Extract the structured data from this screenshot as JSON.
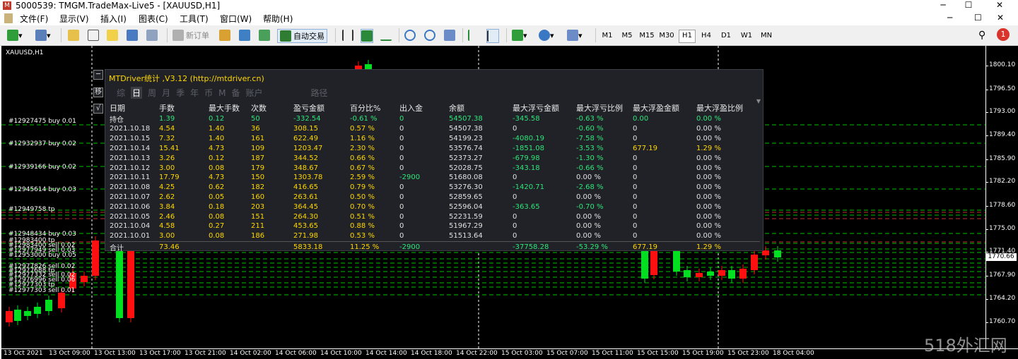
{
  "window": {
    "title": "5000539: TMGM.TradeMax-Live5 - [XAUUSD,H1]",
    "icon_letter": "M",
    "minimize": "─",
    "maximize": "☐",
    "close": "✕"
  },
  "menu": {
    "items": [
      "文件(F)",
      "显示(V)",
      "插入(I)",
      "图表(C)",
      "工具(T)",
      "窗口(W)",
      "帮助(H)"
    ],
    "right_controls": [
      "─",
      "☐",
      "✕"
    ]
  },
  "toolbar": {
    "new_order": "新订单",
    "auto_trading": "自动交易",
    "timeframes": [
      "M1",
      "M5",
      "M15",
      "M30",
      "H1",
      "H4",
      "D1",
      "W1",
      "MN"
    ],
    "active_timeframe": "H1",
    "notification_count": "1"
  },
  "chart": {
    "symbol": "XAUUSD,H1",
    "current_price": "1770.66",
    "price_axis": [
      "1800.10",
      "1796.50",
      "1793.00",
      "1789.40",
      "1785.90",
      "1782.20",
      "1778.60",
      "1775.00",
      "1771.40",
      "1767.90",
      "1764.20",
      "1760.70"
    ],
    "time_axis": [
      "13 Oct 2021",
      "13 Oct 09:00",
      "13 Oct 13:00",
      "13 Oct 17:00",
      "13 Oct 21:00",
      "14 Oct 02:00",
      "14 Oct 06:00",
      "14 Oct 10:00",
      "14 Oct 14:00",
      "14 Oct 18:00",
      "14 Oct 22:00",
      "15 Oct 03:00",
      "15 Oct 07:00",
      "15 Oct 11:00",
      "15 Oct 15:00",
      "15 Oct 19:00",
      "15 Oct 23:00",
      "18 Oct 04:00"
    ],
    "order_labels": [
      "#12927475 buy 0.01",
      "#12932937 buy 0.02",
      "#12939166 buy 0.02",
      "#12945614 buy 0.03",
      "#12949758 tp",
      "#12948434 buy 0.03",
      "#12983400 tp",
      "#12983400 sell 0.02",
      "#12977949 sell 0.03",
      "#12953000 buy 0.05",
      "#12977826 sell 0.02",
      "#12977688 tp",
      "#12977332 sell 0.02",
      "#12976996 sell 0.06",
      "#12977303 tp",
      "#12977303 sell 0.01"
    ],
    "colors": {
      "bull": "#00e020",
      "bear": "#ff1010",
      "grid": "#ffffff",
      "level": "#00c000"
    }
  },
  "stats_panel": {
    "title": "MTDriver统计 ,V3.12 (http://mtdriver.cn)",
    "tabs": [
      "综",
      "日",
      "周",
      "月",
      "季",
      "年",
      "币",
      "M",
      "备",
      "账户",
      "路径"
    ],
    "active_tab": "日",
    "side_buttons": [
      "─",
      "移",
      "√"
    ],
    "headers": [
      "日期",
      "手数",
      "最大手数",
      "次数",
      "盈亏金额",
      "百分比%",
      "出入金",
      "余额",
      "最大浮亏金额",
      "最大浮亏比例",
      "最大浮盈金额",
      "最大浮盈比例"
    ],
    "holding": [
      "持仓",
      "1.39",
      "0.12",
      "50",
      "-332.54",
      "-0.61 %",
      "0",
      "54507.38",
      "-345.58",
      "-0.63 %",
      "0.00",
      "0.00 %"
    ],
    "rows": [
      [
        "2021.10.18",
        "4.54",
        "1.40",
        "36",
        "308.15",
        "0.57 %",
        "0",
        "54507.38",
        "0",
        "-0.60 %",
        "0",
        "0.00 %"
      ],
      [
        "2021.10.15",
        "7.32",
        "1.40",
        "161",
        "622.49",
        "1.16 %",
        "0",
        "54199.23",
        "-4080.19",
        "-7.58 %",
        "0",
        "0.00 %"
      ],
      [
        "2021.10.14",
        "15.41",
        "4.73",
        "109",
        "1203.47",
        "2.30 %",
        "0",
        "53576.74",
        "-1851.08",
        "-3.53 %",
        "677.19",
        "1.29 %"
      ],
      [
        "2021.10.13",
        "3.26",
        "0.12",
        "187",
        "344.52",
        "0.66 %",
        "0",
        "52373.27",
        "-679.98",
        "-1.30 %",
        "0",
        "0.00 %"
      ],
      [
        "2021.10.12",
        "3.00",
        "0.08",
        "179",
        "348.67",
        "0.67 %",
        "0",
        "52028.75",
        "-343.18",
        "-0.66 %",
        "0",
        "0.00 %"
      ],
      [
        "2021.10.11",
        "17.79",
        "4.73",
        "150",
        "1303.78",
        "2.59 %",
        "-2900",
        "51680.08",
        "0",
        "0.00 %",
        "0",
        "0.00 %"
      ],
      [
        "2021.10.08",
        "4.25",
        "0.62",
        "182",
        "416.65",
        "0.79 %",
        "0",
        "53276.30",
        "-1420.71",
        "-2.68 %",
        "0",
        "0.00 %"
      ],
      [
        "2021.10.07",
        "2.62",
        "0.05",
        "160",
        "263.61",
        "0.50 %",
        "0",
        "52859.65",
        "0",
        "0.00 %",
        "0",
        "0.00 %"
      ],
      [
        "2021.10.06",
        "3.84",
        "0.18",
        "203",
        "364.45",
        "0.70 %",
        "0",
        "52596.04",
        "-363.65",
        "-0.70 %",
        "0",
        "0.00 %"
      ],
      [
        "2021.10.05",
        "2.46",
        "0.08",
        "151",
        "264.30",
        "0.51 %",
        "0",
        "52231.59",
        "0",
        "0.00 %",
        "0",
        "0.00 %"
      ],
      [
        "2021.10.04",
        "4.58",
        "0.27",
        "211",
        "453.65",
        "0.88 %",
        "0",
        "51967.29",
        "0",
        "0.00 %",
        "0",
        "0.00 %"
      ],
      [
        "2021.10.01",
        "3.00",
        "0.08",
        "186",
        "271.98",
        "0.53 %",
        "0",
        "51513.64",
        "0",
        "0.00 %",
        "0",
        "0.00 %"
      ]
    ],
    "total": [
      "合计",
      "73.46",
      "",
      "",
      "5833.18",
      "11.25 %",
      "-2900",
      "",
      "-37758.28",
      "-53.29 %",
      "677.19",
      "1.29 %"
    ]
  },
  "watermark": "518外汇网"
}
